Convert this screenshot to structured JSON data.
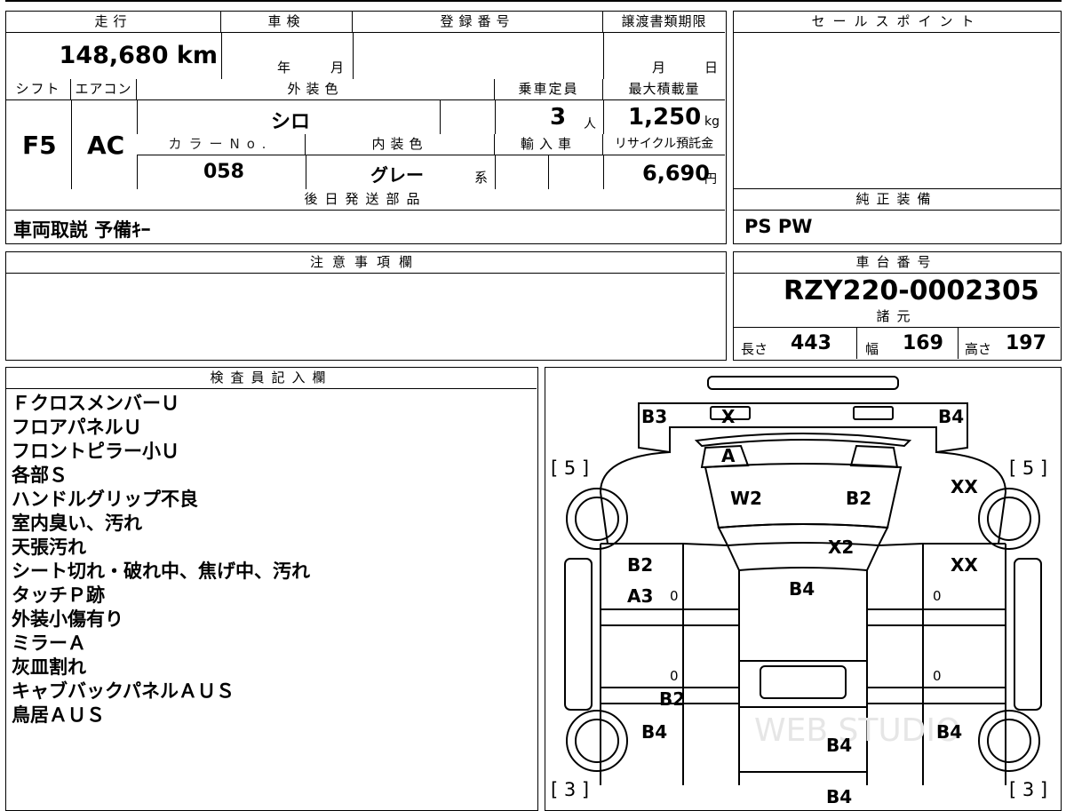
{
  "top_info": {
    "headers": {
      "mileage": "走行",
      "inspection": "車検",
      "registration": "登録番号",
      "transfer_deadline": "譲渡書類期限"
    },
    "mileage_value": "148,680 km",
    "inspection_year": "年",
    "inspection_month": "月",
    "deadline_month": "月",
    "deadline_day": "日"
  },
  "specs": {
    "shift_label": "シフト",
    "aircon_label": "エアコン",
    "exterior_color_label": "外装色",
    "capacity_label": "乗車定員",
    "max_load_label": "最大積載量",
    "shift_value": "F5",
    "aircon_value": "AC",
    "exterior_color_value": "シロ",
    "capacity_value": "3",
    "capacity_unit": "人",
    "max_load_value": "1,250",
    "max_load_unit": "kg",
    "color_no_label": "カラーNo.",
    "interior_color_label": "内装色",
    "import_label": "輸入車",
    "recycle_label": "リサイクル預託金",
    "color_no_value": "058",
    "interior_color_value": "グレー",
    "interior_color_suffix": "系",
    "recycle_value": "6,690",
    "recycle_unit": "円"
  },
  "later_parts": {
    "label": "後日発送部品",
    "value": "車両取説 予備ｷｰ"
  },
  "sales_point": {
    "label": "セールスポイント"
  },
  "genuine_equipment": {
    "label": "純正装備",
    "value": "PS PW"
  },
  "caution": {
    "label": "注意事項欄"
  },
  "chassis": {
    "label": "車台番号",
    "value": "RZY220-0002305"
  },
  "dimensions": {
    "label": "諸元",
    "length_label": "長さ",
    "length_value": "443",
    "width_label": "幅",
    "width_value": "169",
    "height_label": "高さ",
    "height_value": "197"
  },
  "inspector": {
    "label": "検査員記入欄",
    "notes": [
      "ＦクロスメンバーＵ",
      "フロアパネルＵ",
      "フロントピラー小Ｕ",
      "各部Ｓ",
      "ハンドルグリップ不良",
      "室内臭い、汚れ",
      "天張汚れ",
      "シート切れ・破れ中、焦げ中、汚れ",
      "タッチＰ跡",
      "外装小傷有り",
      "ミラーＡ",
      "灰皿割れ",
      "キャブバックパネルＡＵＳ",
      "鳥居ＡＵＳ"
    ]
  },
  "diagram": {
    "marks": {
      "front_left": "B3",
      "front_center": "X",
      "front_right": "B4",
      "windshield": "A",
      "hood_left": "W2",
      "hood_right": "B2",
      "cowl": "X2",
      "fender_right_upper": "XX",
      "fender_right_lower": "XX",
      "door_left_1": "B2",
      "door_left_2": "A3",
      "cab": "B4",
      "bed_left": "B2",
      "rear_left": "B4",
      "rear_center": "B4",
      "rear_right": "B4",
      "rear_bottom": "B4"
    },
    "tire_front_left": "[ 5 ]",
    "tire_front_right": "[ 5 ]",
    "tire_rear_left": "[ 3 ]",
    "tire_rear_right": "[ 3 ]",
    "zero_marks": "0",
    "watermark": "WEB STUDIO"
  }
}
